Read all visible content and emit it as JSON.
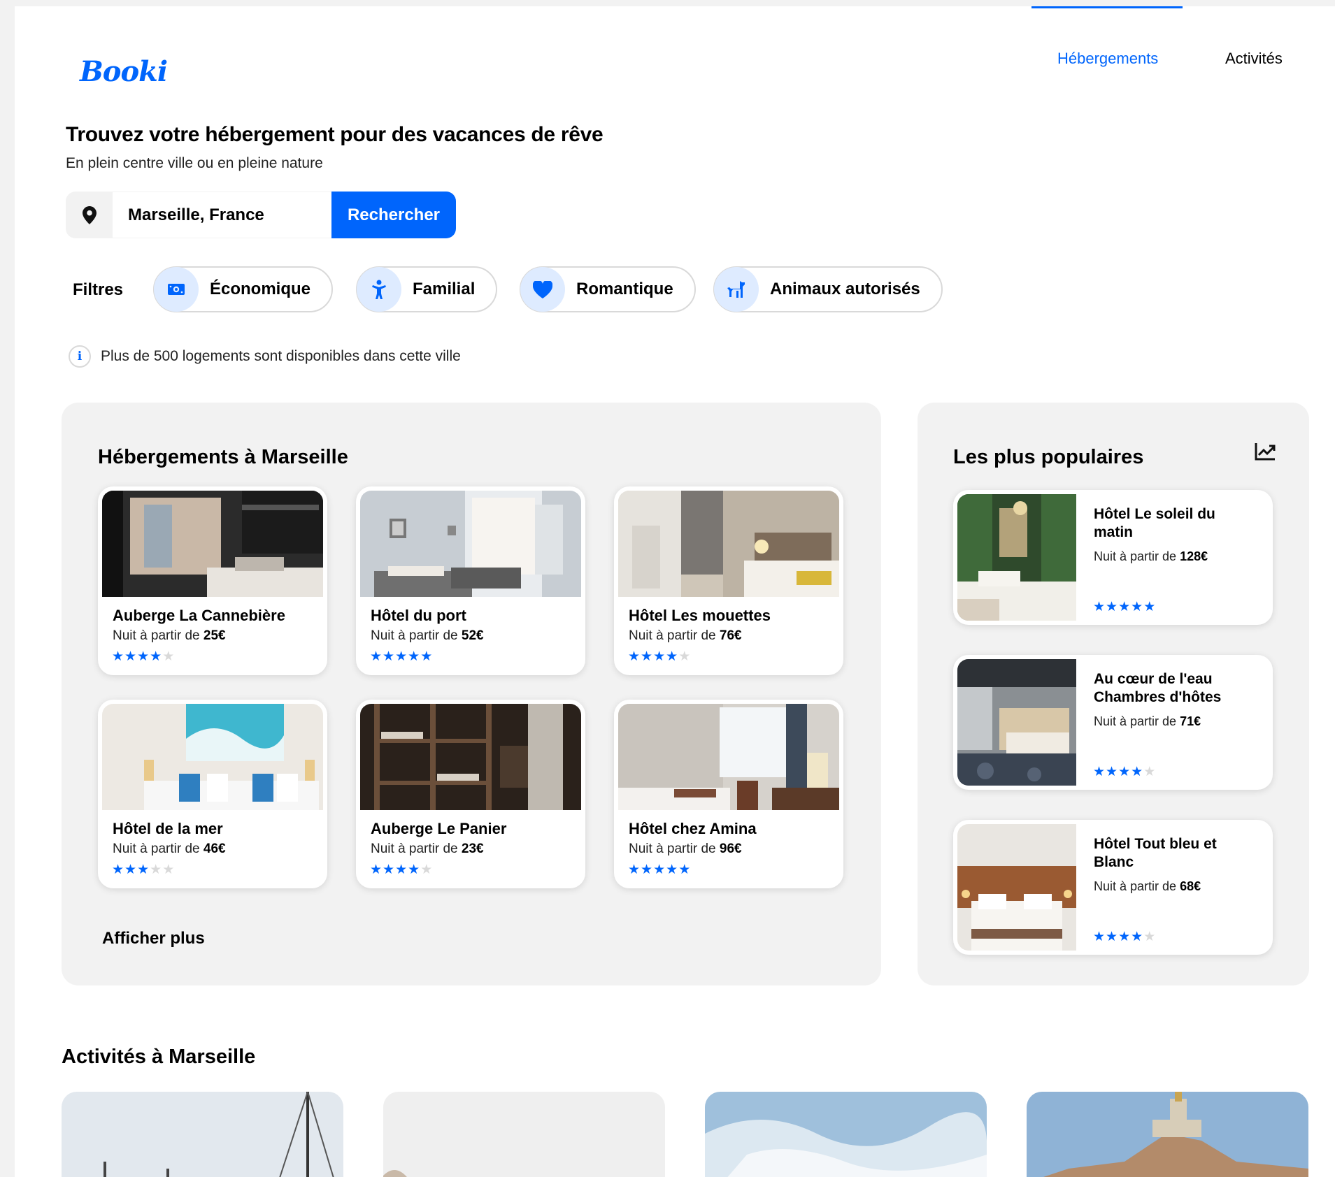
{
  "brand": {
    "logo": "Booki"
  },
  "nav": {
    "items": [
      {
        "label": "Hébergements",
        "active": true
      },
      {
        "label": "Activités",
        "active": false
      }
    ]
  },
  "hero": {
    "title": "Trouvez votre hébergement pour des vacances de rêve",
    "subtitle": "En plein centre ville ou en pleine nature"
  },
  "search": {
    "value": "Marseille, France",
    "button_label": "Rechercher"
  },
  "filters": {
    "label": "Filtres",
    "items": [
      {
        "label": "Économique",
        "icon": "money-icon"
      },
      {
        "label": "Familial",
        "icon": "child-icon"
      },
      {
        "label": "Romantique",
        "icon": "heart-icon"
      },
      {
        "label": "Animaux autorisés",
        "icon": "dog-icon"
      }
    ]
  },
  "info": {
    "text": "Plus de 500 logements sont disponibles dans cette ville",
    "icon": "info-icon"
  },
  "lodgings": {
    "title": "Hébergements à Marseille",
    "price_prefix": "Nuit à partir de ",
    "more_label": "Afficher plus",
    "items": [
      {
        "name": "Auberge La Cannebière",
        "price": "25€",
        "rating": 4
      },
      {
        "name": "Hôtel du port",
        "price": "52€",
        "rating": 5
      },
      {
        "name": "Hôtel Les mouettes",
        "price": "76€",
        "rating": 4
      },
      {
        "name": "Hôtel de la mer",
        "price": "46€",
        "rating": 3
      },
      {
        "name": "Auberge Le Panier",
        "price": "23€",
        "rating": 4
      },
      {
        "name": "Hôtel chez Amina",
        "price": "96€",
        "rating": 5
      }
    ]
  },
  "popular": {
    "title": "Les plus populaires",
    "icon": "trending-up-icon",
    "price_prefix": "Nuit à partir de ",
    "items": [
      {
        "name": "Hôtel Le soleil du matin",
        "price": "128€",
        "rating": 5
      },
      {
        "name": "Au cœur de l'eau Chambres d'hôtes",
        "price": "71€",
        "rating": 4
      },
      {
        "name": "Hôtel Tout bleu et Blanc",
        "price": "68€",
        "rating": 4
      }
    ]
  },
  "activities": {
    "title": "Activités à Marseille"
  },
  "colors": {
    "accent": "#0065fc",
    "accent_light": "#deebff",
    "panel_bg": "#f2f2f2",
    "star_off": "#d9d9d9"
  }
}
